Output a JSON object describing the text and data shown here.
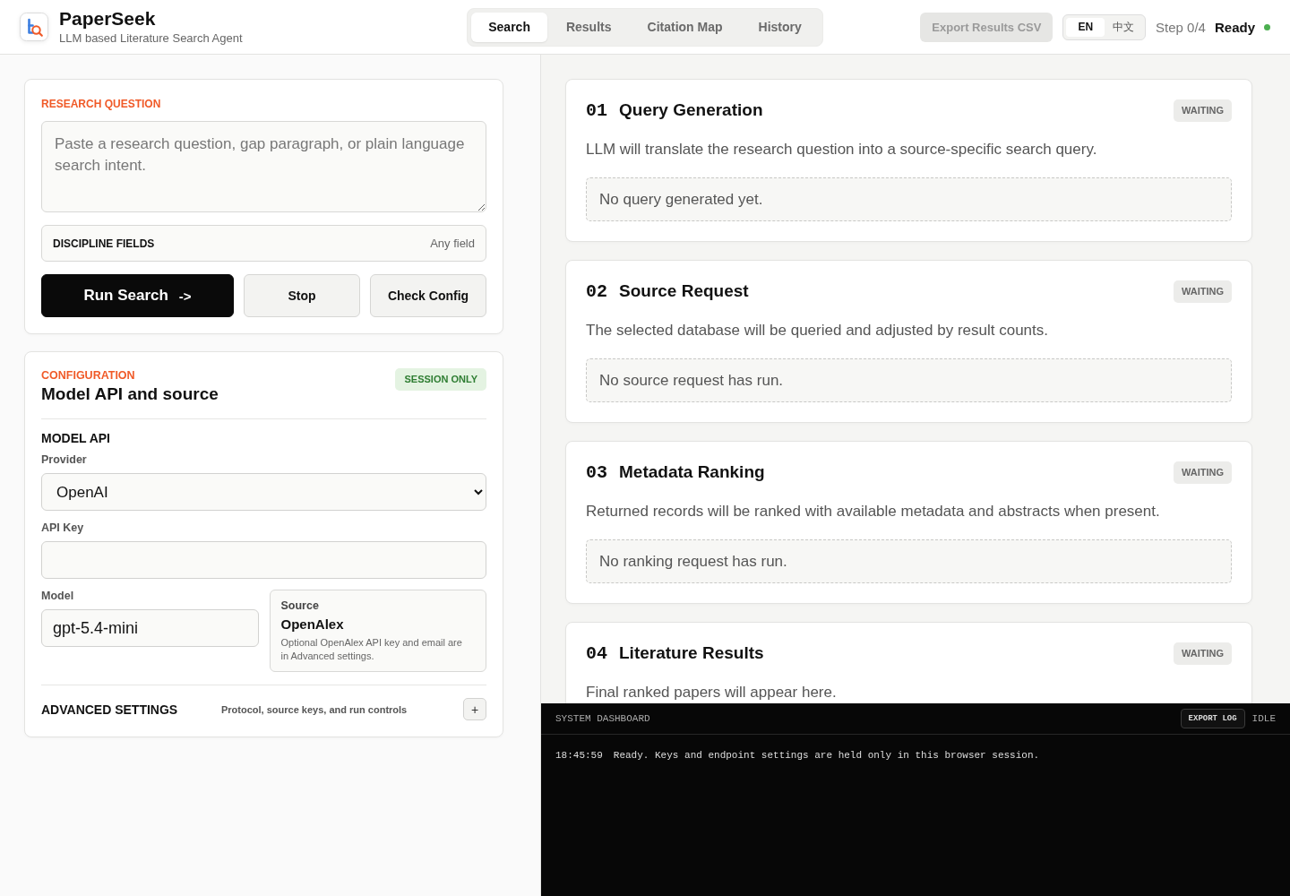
{
  "app": {
    "title": "PaperSeek",
    "subtitle": "LLM based Literature Search Agent"
  },
  "tabs": [
    {
      "label": "Search",
      "selected": true
    },
    {
      "label": "Results",
      "selected": false
    },
    {
      "label": "Citation Map",
      "selected": false
    },
    {
      "label": "History",
      "selected": false
    }
  ],
  "toolbar": {
    "export_button": {
      "label": "Export Results CSV",
      "disabled": true
    },
    "languages": [
      {
        "label": "EN",
        "selected": true
      },
      {
        "label": "中文",
        "selected": false
      }
    ],
    "step": "Step 0/4",
    "status": "Ready"
  },
  "research_question": {
    "heading": "RESEARCH QUESTION",
    "placeholder": "Paste a research question, gap paragraph, or plain language search intent.",
    "discipline": {
      "label": "DISCIPLINE FIELDS",
      "value": "Any field"
    },
    "buttons": [
      {
        "label": "Run Search",
        "arrow": "->",
        "kind": "primary"
      },
      {
        "label": "Stop",
        "kind": "secondary"
      },
      {
        "label": "Check Config",
        "kind": "secondary"
      }
    ]
  },
  "configuration": {
    "eyebrow": "CONFIGURATION",
    "title": "Model API and source",
    "badge": "SESSION ONLY",
    "section": "MODEL API",
    "provider": {
      "label": "Provider",
      "value": "OpenAI"
    },
    "api_key": {
      "label": "API Key"
    },
    "model": {
      "label": "Model",
      "value": "gpt-5.4-mini"
    },
    "source": {
      "label": "Source",
      "name": "OpenAlex",
      "note": "Optional OpenAlex API key and email are in Advanced settings."
    },
    "advanced": {
      "title": "ADVANCED SETTINGS",
      "description": "Protocol, source keys, and run controls",
      "toggle": "+"
    }
  },
  "steps": [
    {
      "number": "01",
      "title": "Query Generation",
      "status": "WAITING",
      "description": "LLM will translate the research question into a source-specific search query.",
      "output": "No query generated yet."
    },
    {
      "number": "02",
      "title": "Source Request",
      "status": "WAITING",
      "description": "The selected database will be queried and adjusted by result counts.",
      "output": "No source request has run."
    },
    {
      "number": "03",
      "title": "Metadata Ranking",
      "status": "WAITING",
      "description": "Returned records will be ranked with available metadata and abstracts when present.",
      "output": "No ranking request has run."
    },
    {
      "number": "04",
      "title": "Literature Results",
      "status": "WAITING",
      "description": "Final ranked papers will appear here."
    }
  ],
  "dashboard": {
    "title": "SYSTEM DASHBOARD",
    "export_button": "EXPORT LOG",
    "status": "IDLE",
    "log": [
      {
        "time": "18:45:59",
        "message": "Ready. Keys and endpoint settings are held only in this browser session."
      }
    ]
  }
}
